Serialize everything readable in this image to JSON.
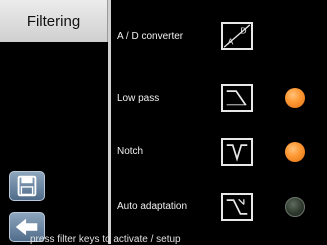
{
  "sidebar": {
    "tab_label": "Filtering",
    "buttons": [
      {
        "icon": "floppy-disk-icon"
      },
      {
        "icon": "back-arrow-icon"
      }
    ]
  },
  "filters": [
    {
      "label": "A / D converter",
      "icon": "ad-converter-icon",
      "indicator": null
    },
    {
      "label": "Low pass",
      "icon": "low-pass-filter-icon",
      "indicator": "on"
    },
    {
      "label": "Notch",
      "icon": "notch-filter-icon",
      "indicator": "on"
    },
    {
      "label": "Auto adaptation",
      "icon": "auto-adaptation-icon",
      "indicator": "off"
    }
  ],
  "footer": {
    "hint": "press filter keys to activate / setup"
  },
  "colors": {
    "indicator_on": "#ff9a36",
    "indicator_off": "#2f3a2f",
    "tab_background": "#e0e0e0",
    "button_background": "#6f88a3"
  }
}
